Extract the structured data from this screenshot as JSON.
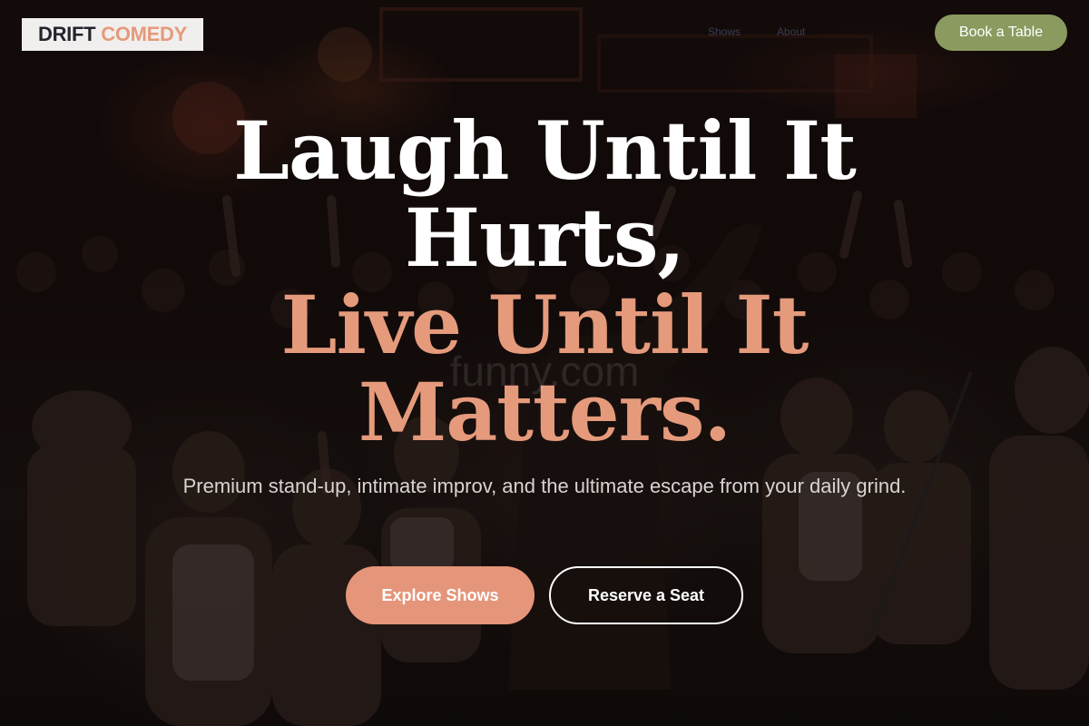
{
  "header": {
    "logo_word_1": "DRIFT",
    "logo_word_2": "COMEDY",
    "nav_items": [
      "Shows",
      "About"
    ],
    "book_button": "Book a Table"
  },
  "hero": {
    "headline_line_1": "Laugh Until It",
    "headline_line_2": "Hurts,",
    "headline_line_3": "Live Until It",
    "headline_line_4": "Matters.",
    "watermark": "funny.com",
    "subtitle": "Premium stand-up, intimate improv, and the ultimate escape from your daily grind.",
    "primary_button": "Explore Shows",
    "secondary_button": "Reserve a Seat"
  },
  "colors": {
    "accent": "#e59a7c",
    "book_button_bg": "#8b9b5f",
    "headline_white": "#ffffff",
    "logo_bg": "#f1efee",
    "logo_dark": "#23242c"
  },
  "background_image": {
    "subject": "concert-crowd-photo"
  }
}
